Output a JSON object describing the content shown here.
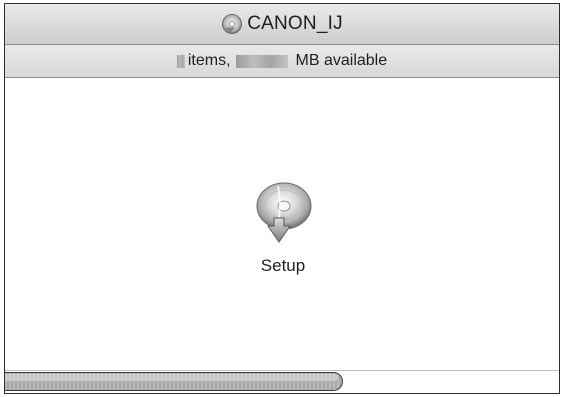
{
  "window": {
    "title": "CANON_IJ",
    "title_icon": "disc-icon"
  },
  "status": {
    "items_label": "items,",
    "available_label": "MB available"
  },
  "files": [
    {
      "label": "Setup",
      "icon": "setup-installer-icon"
    }
  ],
  "scrollbar": {
    "position_fraction": 0.61
  }
}
